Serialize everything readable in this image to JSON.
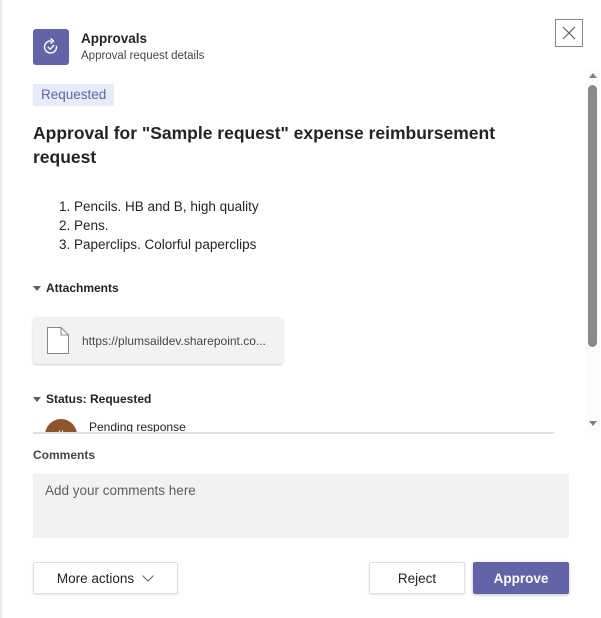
{
  "header": {
    "app_title": "Approvals",
    "app_subtitle": "Approval request details",
    "app_icon": "approvals-icon",
    "close_icon": "close-icon"
  },
  "request": {
    "status_badge": "Requested",
    "title": "Approval for \"Sample request\" expense reimbursement request",
    "items": [
      "1. Pencils. HB and B, high quality",
      "2. Pens.",
      "3. Paperclips. Colorful paperclips"
    ]
  },
  "attachments": {
    "label": "Attachments",
    "files": [
      {
        "icon": "file-icon",
        "link": "https://plumsaildev.sharepoint.co..."
      }
    ]
  },
  "status": {
    "label": "Status: Requested",
    "approvers": [
      {
        "avatar_initials": "II",
        "avatar_color": "#8e562e",
        "response": "Pending response"
      }
    ]
  },
  "comments": {
    "label": "Comments",
    "placeholder": "Add your comments here",
    "value": ""
  },
  "actions": {
    "more_actions_label": "More actions",
    "reject_label": "Reject",
    "approve_label": "Approve"
  },
  "colors": {
    "brand": "#6264a7",
    "badge_bg": "#e8ebfa",
    "input_bg": "#f3f2f1"
  }
}
